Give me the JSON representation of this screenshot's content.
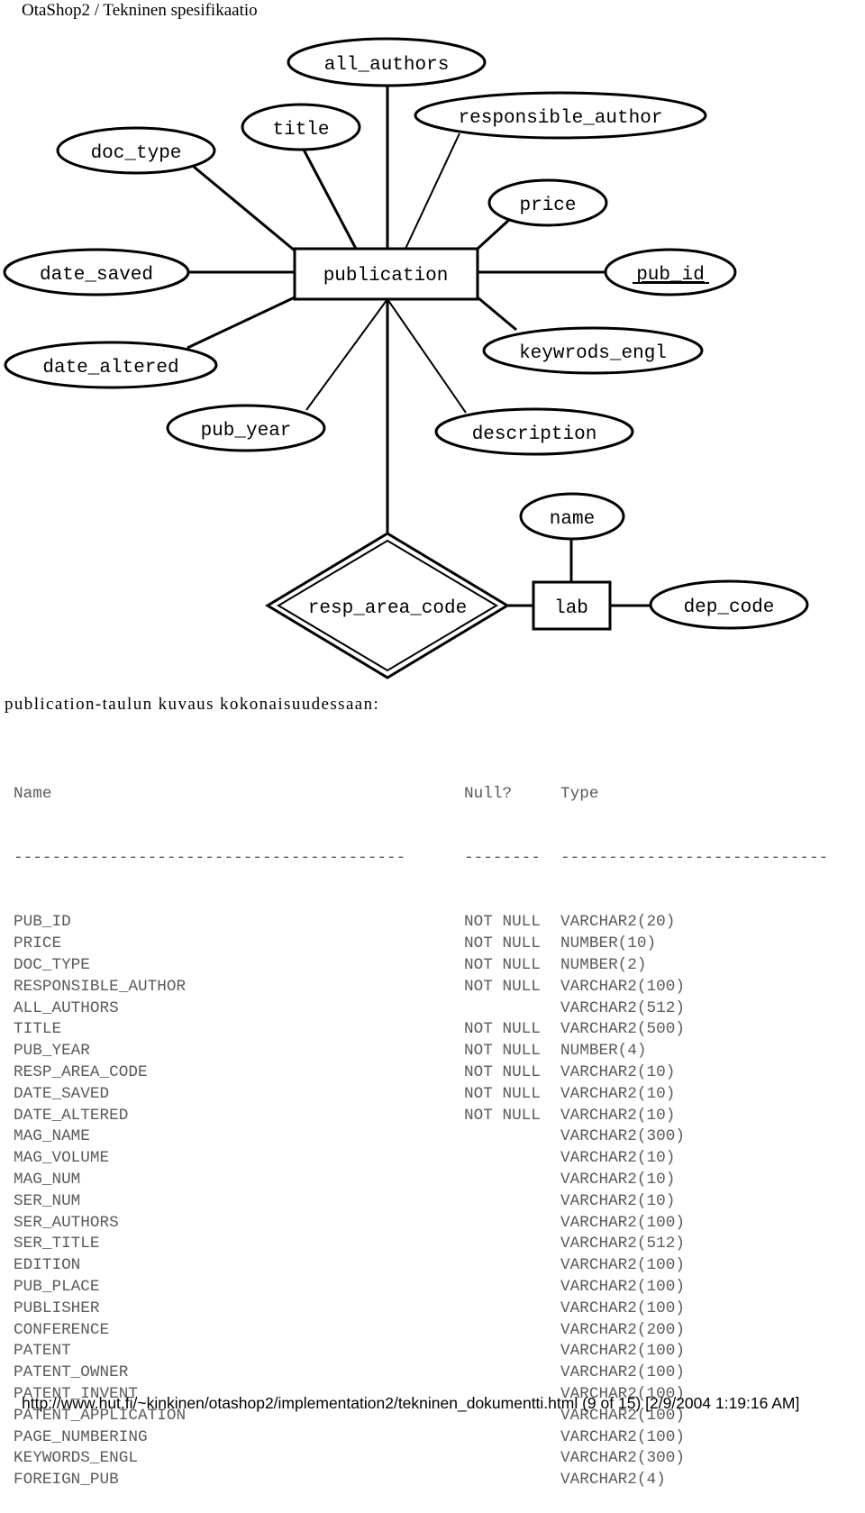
{
  "header": {
    "title": "OtaShop2 / Tekninen spesifikaatio"
  },
  "diagram": {
    "entities": {
      "publication": "publication",
      "lab": "lab"
    },
    "relationship": {
      "label": "resp_area_code",
      "kind": "identifying (double diamond)"
    },
    "attributes": {
      "all_authors": "all_authors",
      "title": "title",
      "doc_type": "doc_type",
      "responsible_author": "responsible_author",
      "price": "price",
      "date_saved": "date_saved",
      "pub_id": "pub_id",
      "date_altered": "date_altered",
      "keywrods_engl": "keywrods_engl",
      "pub_year": "pub_year",
      "description": "description",
      "name": "name",
      "dep_code": "dep_code"
    },
    "primary_key": "pub_id"
  },
  "caption": "publication-taulun kuvaus kokonaisuudessaan:",
  "schema": {
    "headers": {
      "name": "Name",
      "null": "Null?",
      "type": "Type"
    },
    "separators": {
      "name": "-----------------------------------------",
      "null": "--------",
      "type": "----------------------------"
    },
    "rows": [
      {
        "name": "PUB_ID",
        "null": "NOT NULL",
        "type": "VARCHAR2(20)"
      },
      {
        "name": "PRICE",
        "null": "NOT NULL",
        "type": "NUMBER(10)"
      },
      {
        "name": "DOC_TYPE",
        "null": "NOT NULL",
        "type": "NUMBER(2)"
      },
      {
        "name": "RESPONSIBLE_AUTHOR",
        "null": "NOT NULL",
        "type": "VARCHAR2(100)"
      },
      {
        "name": "ALL_AUTHORS",
        "null": "",
        "type": "VARCHAR2(512)"
      },
      {
        "name": "TITLE",
        "null": "NOT NULL",
        "type": "VARCHAR2(500)"
      },
      {
        "name": "PUB_YEAR",
        "null": "NOT NULL",
        "type": "NUMBER(4)"
      },
      {
        "name": "RESP_AREA_CODE",
        "null": "NOT NULL",
        "type": "VARCHAR2(10)"
      },
      {
        "name": "DATE_SAVED",
        "null": "NOT NULL",
        "type": "VARCHAR2(10)"
      },
      {
        "name": "DATE_ALTERED",
        "null": "NOT NULL",
        "type": "VARCHAR2(10)"
      },
      {
        "name": "MAG_NAME",
        "null": "",
        "type": "VARCHAR2(300)"
      },
      {
        "name": "MAG_VOLUME",
        "null": "",
        "type": "VARCHAR2(10)"
      },
      {
        "name": "MAG_NUM",
        "null": "",
        "type": "VARCHAR2(10)"
      },
      {
        "name": "SER_NUM",
        "null": "",
        "type": "VARCHAR2(10)"
      },
      {
        "name": "SER_AUTHORS",
        "null": "",
        "type": "VARCHAR2(100)"
      },
      {
        "name": "SER_TITLE",
        "null": "",
        "type": "VARCHAR2(512)"
      },
      {
        "name": "EDITION",
        "null": "",
        "type": "VARCHAR2(100)"
      },
      {
        "name": "PUB_PLACE",
        "null": "",
        "type": "VARCHAR2(100)"
      },
      {
        "name": "PUBLISHER",
        "null": "",
        "type": "VARCHAR2(100)"
      },
      {
        "name": "CONFERENCE",
        "null": "",
        "type": "VARCHAR2(200)"
      },
      {
        "name": "PATENT",
        "null": "",
        "type": "VARCHAR2(100)"
      },
      {
        "name": "PATENT_OWNER",
        "null": "",
        "type": "VARCHAR2(100)"
      },
      {
        "name": "PATENT_INVENT",
        "null": "",
        "type": "VARCHAR2(100)"
      },
      {
        "name": "PATENT_APPLICATION",
        "null": "",
        "type": "VARCHAR2(100)"
      },
      {
        "name": "PAGE_NUMBERING",
        "null": "",
        "type": "VARCHAR2(100)"
      },
      {
        "name": "KEYWORDS_ENGL",
        "null": "",
        "type": "VARCHAR2(300)"
      },
      {
        "name": "FOREIGN_PUB",
        "null": "",
        "type": "VARCHAR2(4)"
      }
    ]
  },
  "footer": {
    "text": "http://www.hut.fi/~kinkinen/otashop2/implementation2/tekninen_dokumentti.html (9 of 15) [2/9/2004 1:19:16 AM]"
  }
}
